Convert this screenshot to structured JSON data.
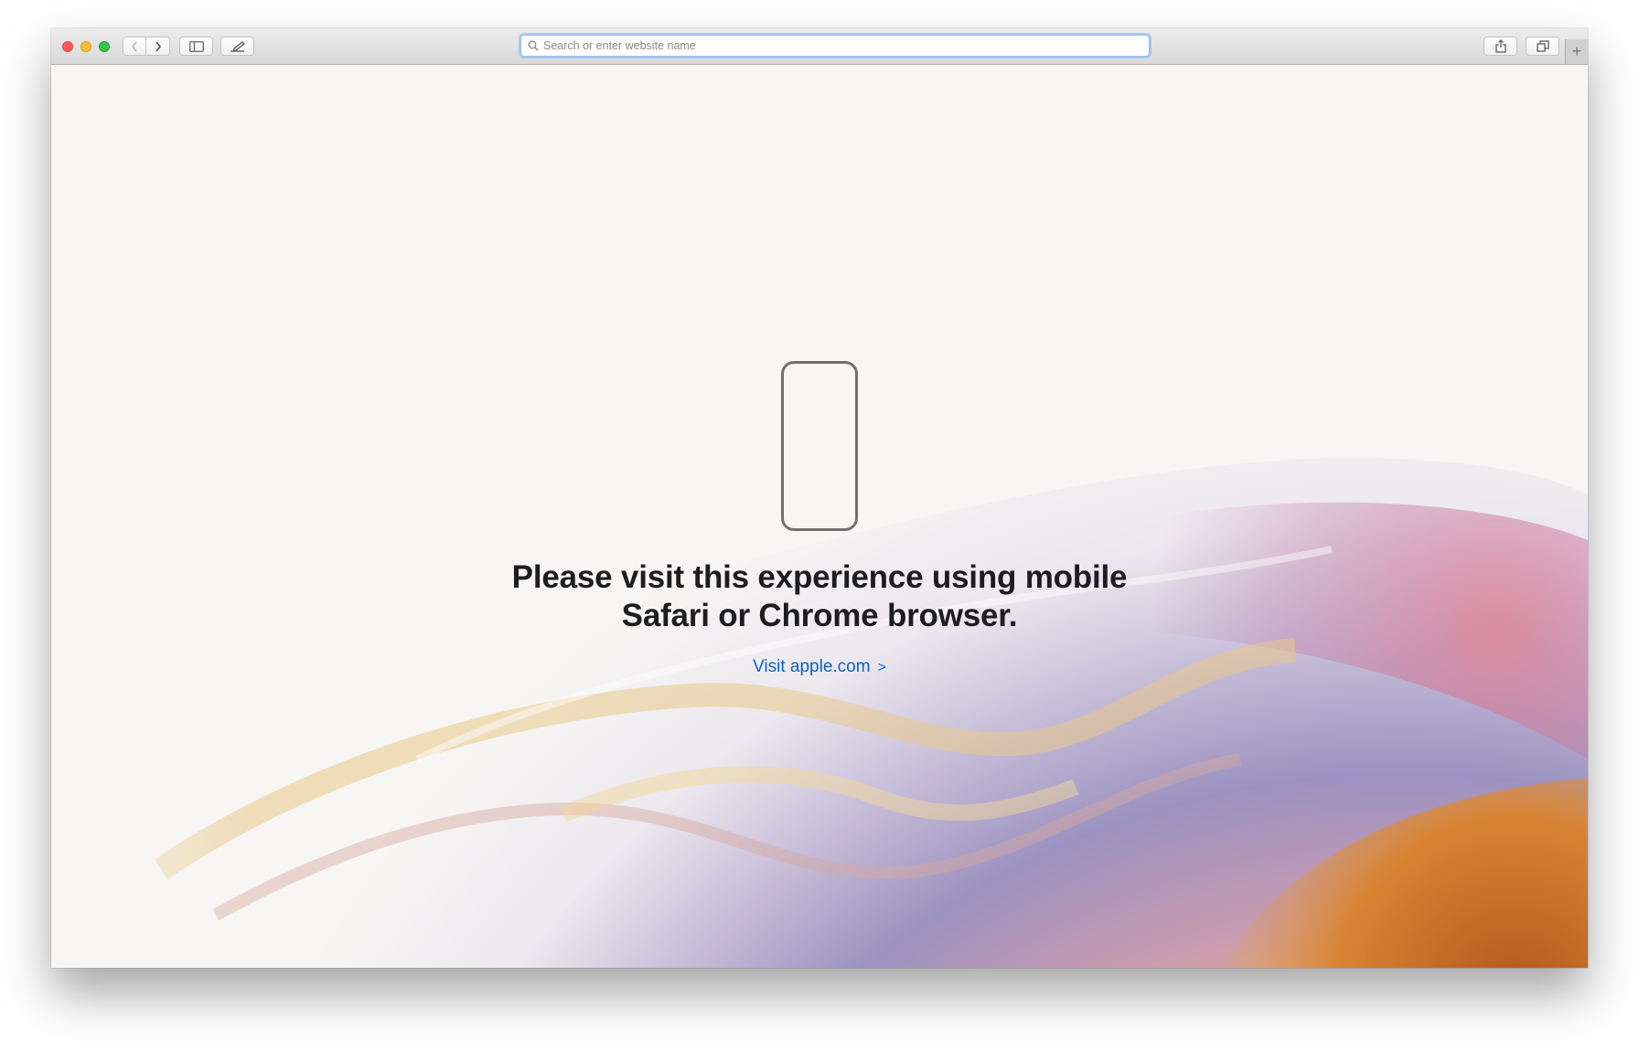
{
  "browser": {
    "address_bar": {
      "placeholder": "Search or enter website name",
      "value": ""
    },
    "new_tab_label": "+"
  },
  "page": {
    "headline_line1": "Please visit this experience using mobile",
    "headline_line2": "Safari or Chrome browser.",
    "link_text": "Visit apple.com",
    "link_chevron": ">"
  },
  "colors": {
    "link": "#0a63c6",
    "headline": "#1d1d1f",
    "background": "#f7f6f4"
  }
}
